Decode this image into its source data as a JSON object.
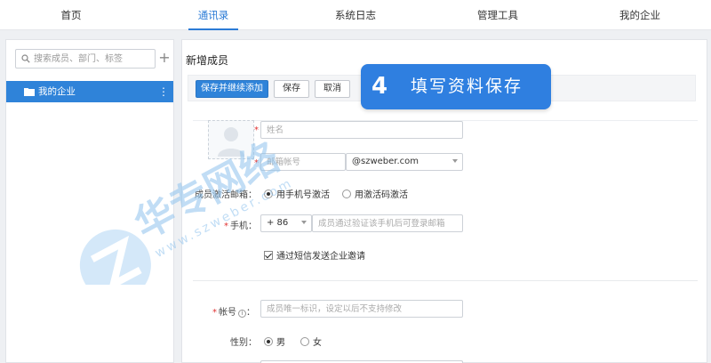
{
  "nav": {
    "tabs": [
      {
        "label": "首页"
      },
      {
        "label": "通讯录"
      },
      {
        "label": "系统日志"
      },
      {
        "label": "管理工具"
      },
      {
        "label": "我的企业"
      }
    ]
  },
  "sidebar": {
    "search_placeholder": "搜索成员、部门、标签",
    "add_icon": "plus-icon",
    "tree": [
      {
        "label": "我的企业",
        "icon": "folder-icon"
      }
    ]
  },
  "main": {
    "title": "新增成员",
    "toolbar": {
      "save_continue": "保存并继续添加",
      "save": "保存",
      "cancel": "取消"
    },
    "callout": {
      "number": "4",
      "text": "填写资料保存",
      "color": "#2f7fe0"
    },
    "form": {
      "name_placeholder": "姓名",
      "email_placeholder": "邮箱帐号",
      "email_domain": "@szweber.com",
      "activation_label": "成员激活邮箱：",
      "activation_options": [
        "用手机号激活",
        "用激活码激活"
      ],
      "phone_label": "手机：",
      "phone_code": "+ 86",
      "phone_placeholder": "成员通过验证该手机后可登录邮箱",
      "sms_invite_label": "通过短信发送企业邀请",
      "account_label": "帐号",
      "account_placeholder": "成员唯一标识，设定以后不支持修改",
      "gender_label": "性别：",
      "gender_options": [
        "男",
        "女"
      ]
    }
  },
  "watermark": {
    "brand": "华专网络",
    "url": "www.szweber.com"
  },
  "colors": {
    "accent": "#2b7bd6",
    "primary_button": "#2f83d9",
    "required": "#e03131"
  }
}
